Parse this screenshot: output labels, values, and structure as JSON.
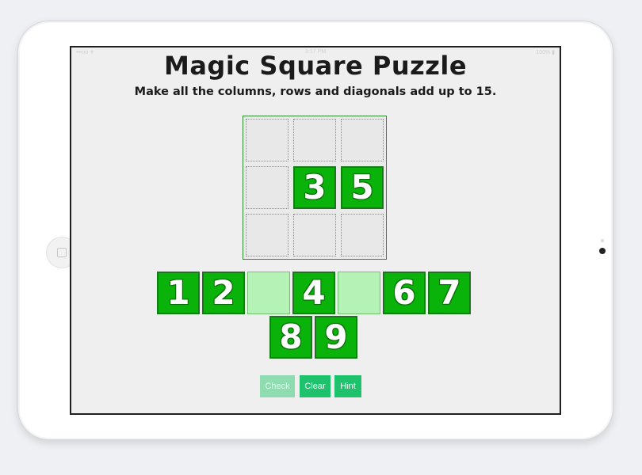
{
  "status_bar": {
    "carrier": "•••oo  ✈",
    "time": "3:17 PM",
    "battery": "100% ▮"
  },
  "header": {
    "title": "Magic Square Puzzle",
    "instructions": "Make all the columns, rows and diagonals add up to 15."
  },
  "board": {
    "cells": [
      {
        "row": 0,
        "col": 0,
        "value": ""
      },
      {
        "row": 0,
        "col": 1,
        "value": ""
      },
      {
        "row": 0,
        "col": 2,
        "value": ""
      },
      {
        "row": 1,
        "col": 0,
        "value": ""
      },
      {
        "row": 1,
        "col": 1,
        "value": "3"
      },
      {
        "row": 1,
        "col": 2,
        "value": "5"
      },
      {
        "row": 2,
        "col": 0,
        "value": ""
      },
      {
        "row": 2,
        "col": 1,
        "value": ""
      },
      {
        "row": 2,
        "col": 2,
        "value": ""
      }
    ]
  },
  "tray": {
    "tiles": [
      {
        "value": "1",
        "placed": false
      },
      {
        "value": "2",
        "placed": false
      },
      {
        "value": "",
        "placed": true
      },
      {
        "value": "4",
        "placed": false
      },
      {
        "value": "",
        "placed": true
      },
      {
        "value": "6",
        "placed": false
      },
      {
        "value": "7",
        "placed": false
      },
      {
        "value": "8",
        "placed": false
      },
      {
        "value": "9",
        "placed": false
      }
    ]
  },
  "controls": {
    "check": {
      "label": "Check",
      "enabled": false
    },
    "clear": {
      "label": "Clear",
      "enabled": true
    },
    "hint": {
      "label": "Hint",
      "enabled": true
    }
  },
  "colors": {
    "tile_fill": "#0ab30a",
    "tile_empty": "#b5f2b5",
    "button": "#1fc26c",
    "button_disabled": "#8fdcb0"
  }
}
